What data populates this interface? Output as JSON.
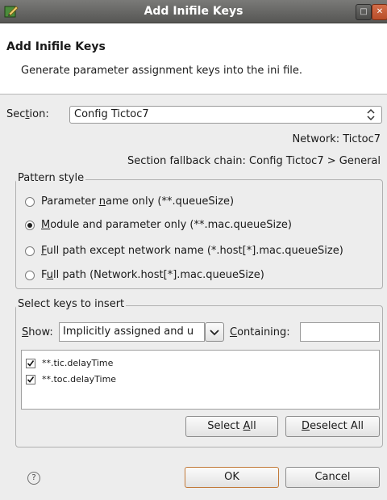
{
  "window": {
    "title": "Add Inifile Keys",
    "minimize_glyph": "□",
    "close_glyph": "✕"
  },
  "header": {
    "title": "Add Inifile Keys",
    "description": "Generate parameter assignment keys into the ini file."
  },
  "section": {
    "label_pre": "Sec",
    "label_mnemonic": "t",
    "label_post": "ion:",
    "selected": "Config Tictoc7"
  },
  "network_info": "Network: Tictoc7",
  "fallback_chain": "Section fallback chain: Config Tictoc7 > General",
  "pattern_style": {
    "legend": "Pattern style",
    "selected_index": 1,
    "options": [
      {
        "pre": "Parameter ",
        "mn": "n",
        "post": "ame only (**.queueSize)"
      },
      {
        "pre": "",
        "mn": "M",
        "post": "odule and parameter only (**.mac.queueSize)"
      },
      {
        "pre": "",
        "mn": "F",
        "post": "ull path except network name (*.host[*].mac.queueSize)"
      },
      {
        "pre": "F",
        "mn": "u",
        "post": "ll path (Network.host[*].mac.queueSize)"
      }
    ]
  },
  "select_keys": {
    "legend": "Select keys to insert",
    "show_pre": "",
    "show_mn": "S",
    "show_post": "how:",
    "show_value": "Implicitly assigned and u",
    "containing_pre": "",
    "containing_mn": "C",
    "containing_post": "ontaining:",
    "containing_value": "",
    "keys": [
      {
        "label": "**.tic.delayTime",
        "checked": true
      },
      {
        "label": "**.toc.delayTime",
        "checked": true
      }
    ],
    "select_all_pre": "Select ",
    "select_all_mn": "A",
    "select_all_post": "ll",
    "deselect_all_pre": "",
    "deselect_all_mn": "D",
    "deselect_all_post": "eselect All"
  },
  "footer": {
    "help_glyph": "?",
    "ok_label": "OK",
    "cancel_label": "Cancel"
  },
  "colors": {
    "titlebar": "#5f5f5d",
    "background": "#ededed",
    "default_button_border": "#c27a3a"
  }
}
